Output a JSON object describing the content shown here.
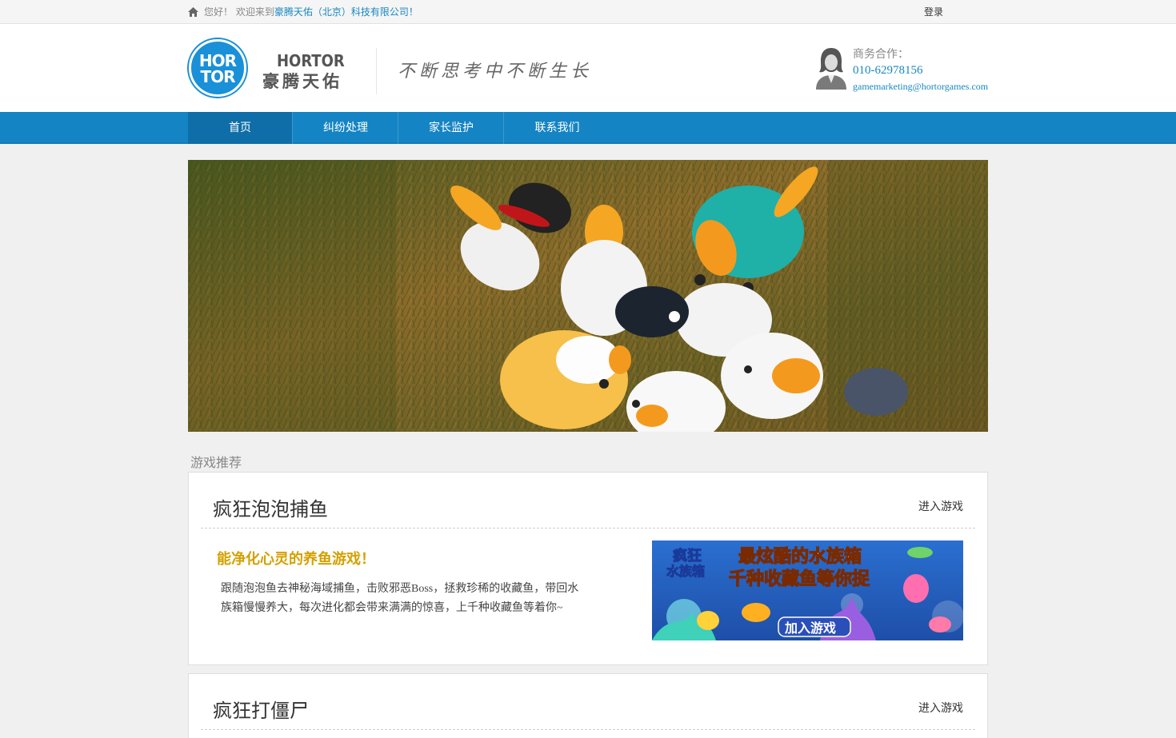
{
  "topbar": {
    "welcome_prefix": "您好！ 欢迎来到",
    "company": "豪腾天佑（北京）科技有限公司",
    "welcome_suffix": "！",
    "login": "登录"
  },
  "header": {
    "logo_line1": "HOR",
    "logo_line2": "TOR",
    "logo_en": "HORTOR",
    "logo_cn": "豪腾天佑",
    "slogan": "不断思考中不断生长",
    "biz_label": "商务合作：",
    "biz_phone": "010-62978156",
    "biz_email": "gamemarketing@hortorgames.com"
  },
  "nav": {
    "items": [
      {
        "label": "首页",
        "active": true
      },
      {
        "label": "纠纷处理",
        "active": false
      },
      {
        "label": "家长监护",
        "active": false
      },
      {
        "label": "联系我们",
        "active": false
      }
    ]
  },
  "section": {
    "title": "游戏推荐"
  },
  "games": [
    {
      "title": "疯狂泡泡捕鱼",
      "enter": "进入游戏",
      "tagline": "能净化心灵的养鱼游戏！",
      "description": "跟随泡泡鱼去神秘海域捕鱼，击败邪恶Boss，拯救珍稀的收藏鱼，带回水族箱慢慢养大，每次进化都会带来满满的惊喜，上千种收藏鱼等着你~",
      "image_text_1": "疯狂",
      "image_text_2": "水族箱",
      "image_text_3": "最炫酷的水族箱",
      "image_text_4": "千种收藏鱼等你捉",
      "image_text_5": "加入游戏"
    },
    {
      "title": "疯狂打僵尸",
      "enter": "进入游戏"
    }
  ],
  "colors": {
    "accent": "#1584c4",
    "nav_active": "#0f6ea7",
    "link": "#1887c0",
    "tagline": "#d4a000"
  }
}
